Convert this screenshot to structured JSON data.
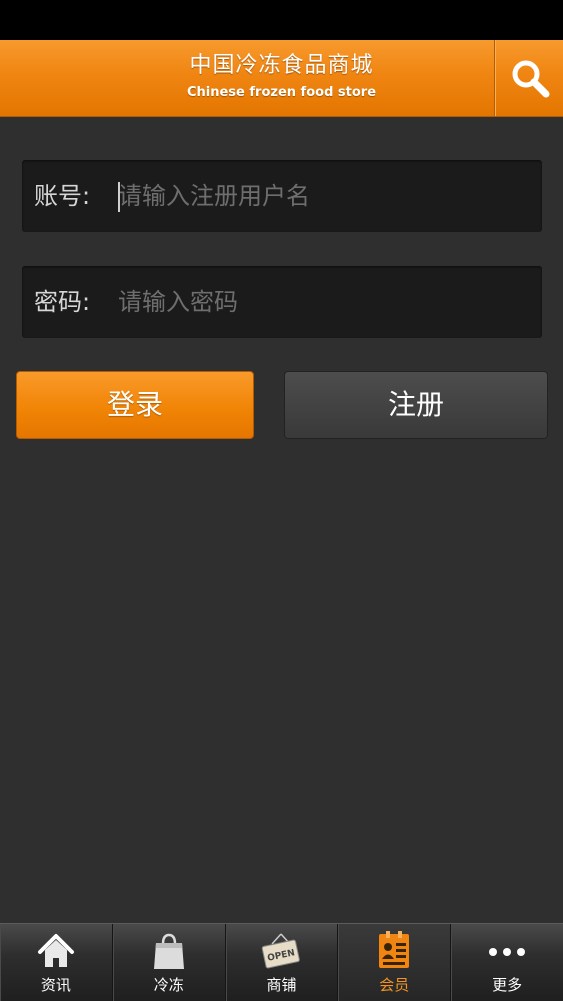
{
  "header": {
    "title": "中国冷冻食品商城",
    "subtitle": "Chinese frozen food store",
    "search_icon": "search-icon"
  },
  "login_form": {
    "account": {
      "label": "账号:",
      "placeholder": "请输入注册用户名",
      "value": ""
    },
    "password": {
      "label": "密码:",
      "placeholder": "请输入密码",
      "value": ""
    },
    "login_label": "登录",
    "register_label": "注册"
  },
  "tabbar": {
    "items": [
      {
        "label": "资讯",
        "icon": "home-icon",
        "active": false
      },
      {
        "label": "冷冻",
        "icon": "shopping-bag-icon",
        "active": false
      },
      {
        "label": "商铺",
        "icon": "open-sign-icon",
        "active": false
      },
      {
        "label": "会员",
        "icon": "member-card-icon",
        "active": true
      },
      {
        "label": "更多",
        "icon": "more-dots-icon",
        "active": false
      }
    ]
  },
  "colors": {
    "accent": "#f08512",
    "background": "#2f2f2f",
    "field": "#1b1b1b",
    "active_tab_label": "#f29323"
  }
}
